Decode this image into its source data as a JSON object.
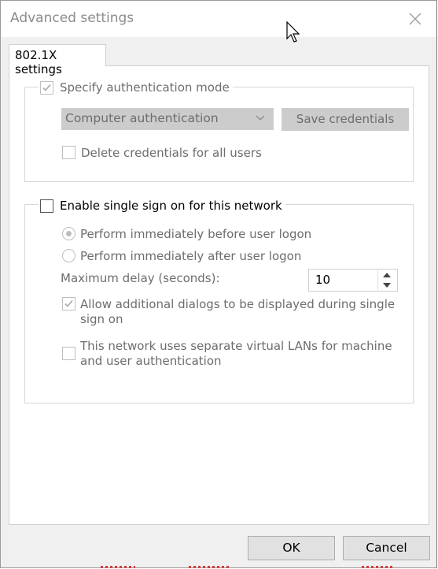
{
  "window": {
    "title": "Advanced settings",
    "close_icon": "close-icon"
  },
  "tabs": [
    {
      "label": "802.1X settings",
      "selected": true
    }
  ],
  "auth_group": {
    "specify_label": "Specify authentication mode",
    "specify_checked": true,
    "mode_selected": "Computer authentication",
    "save_credentials_label": "Save credentials",
    "delete_credentials_label": "Delete credentials for all users",
    "delete_credentials_checked": false
  },
  "sso_group": {
    "enable_label": "Enable single sign on for this network",
    "enable_checked": false,
    "radio_before_label": "Perform immediately before user logon",
    "radio_before_selected": true,
    "radio_after_label": "Perform immediately after user logon",
    "radio_after_selected": false,
    "max_delay_label": "Maximum delay (seconds):",
    "max_delay_value": "10",
    "allow_dialogs_label_line1": "Allow additional dialogs to be displayed during single",
    "allow_dialogs_label_line2": "sign on",
    "allow_dialogs_checked": true,
    "vlan_label_line1": "This network uses separate virtual LANs for machine",
    "vlan_label_line2": "and user authentication",
    "vlan_checked": false
  },
  "footer": {
    "ok_label": "OK",
    "cancel_label": "Cancel"
  },
  "colors": {
    "disabled_text": "#6d6d6d",
    "disabled_fill": "#cccccc",
    "dialog_bg": "#f0f0f0"
  }
}
